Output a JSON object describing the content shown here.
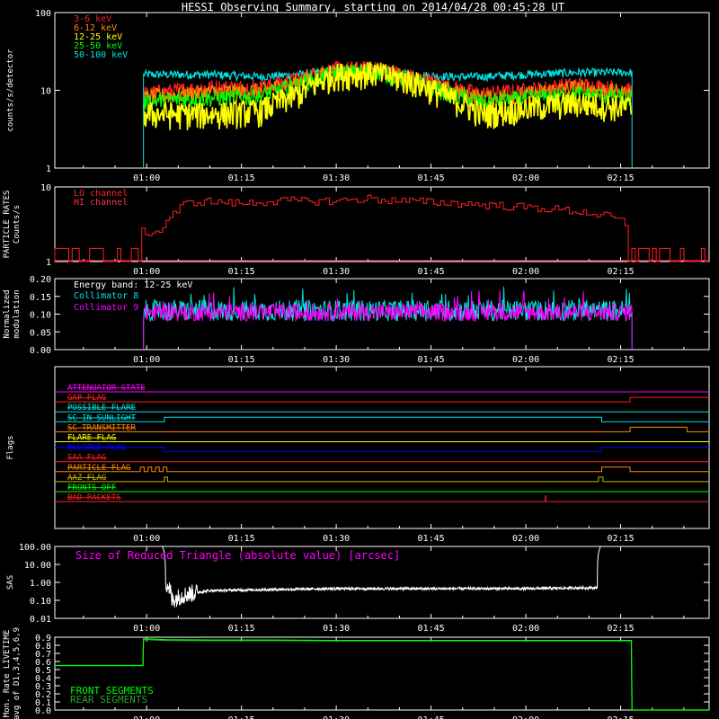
{
  "title": "HESSI Observing Summary, starting on 2014/04/28 00:45:28 UT",
  "x_ticks": [
    "01:00",
    "01:15",
    "01:30",
    "01:45",
    "02:00",
    "02:15"
  ],
  "x_tick_minutes": [
    60,
    75,
    90,
    105,
    120,
    135
  ],
  "x_range_minutes": [
    45.47,
    149
  ],
  "colors": {
    "white": "#ffffff",
    "red": "#ff2020",
    "orange": "#ff8800",
    "yellow": "#ffff00",
    "green": "#00ff00",
    "cyan": "#00e5e5",
    "magenta": "#ff00ff",
    "blue": "#0000ff",
    "darkyellow": "#c8b400",
    "olive": "#a08c00"
  },
  "chart_data": [
    {
      "type": "line",
      "panel": "count_rates",
      "ylabel": "counts/s/detector",
      "yscale": "log",
      "ylim": [
        1,
        100
      ],
      "y_ticks": [
        "1",
        "10",
        "100"
      ],
      "y_tick_values": [
        1,
        10,
        100
      ],
      "legend_position": "top-left",
      "data_span_minutes": [
        59.5,
        136.8
      ],
      "series": [
        {
          "name": "3-6 keV",
          "color": "#ff2020",
          "x": [
            59.5,
            62,
            70,
            78,
            84,
            90,
            96,
            102,
            108,
            113,
            120,
            128,
            136.8
          ],
          "y": [
            9,
            9.5,
            11,
            11,
            14,
            19,
            19,
            15,
            11,
            9,
            10,
            12,
            10
          ]
        },
        {
          "name": "6-12 keV",
          "color": "#ff8800",
          "x": [
            59.5,
            62,
            70,
            78,
            84,
            90,
            96,
            102,
            108,
            113,
            120,
            128,
            136.8
          ],
          "y": [
            8,
            8.5,
            9.5,
            10,
            13,
            18,
            18,
            14,
            10,
            8,
            9,
            11,
            9
          ]
        },
        {
          "name": "12-25 keV",
          "color": "#ffff00",
          "x": [
            59.5,
            62,
            70,
            78,
            84,
            90,
            96,
            102,
            108,
            113,
            120,
            128,
            136.8
          ],
          "y": [
            5,
            5,
            5,
            5.5,
            9,
            16,
            17,
            13,
            8,
            5,
            6,
            7,
            6
          ]
        },
        {
          "name": "25-50 keV",
          "color": "#00ff00",
          "x": [
            59.5,
            62,
            70,
            78,
            84,
            90,
            96,
            102,
            108,
            113,
            120,
            128,
            136.8
          ],
          "y": [
            7,
            7.5,
            8,
            8.5,
            12,
            17,
            17.5,
            13,
            9,
            7,
            8,
            9,
            8
          ]
        },
        {
          "name": "50-100 keV",
          "color": "#00e5e5",
          "x": [
            59.5,
            62,
            70,
            78,
            84,
            90,
            96,
            102,
            108,
            113,
            120,
            128,
            136.8
          ],
          "y": [
            16,
            16,
            16,
            15,
            16,
            18,
            18,
            16,
            15,
            15,
            16,
            17,
            17
          ]
        }
      ]
    },
    {
      "type": "line",
      "panel": "particle_rates",
      "ylabel": [
        "PARTICLE RATES",
        "Counts/s"
      ],
      "yscale": "log",
      "ylim": [
        1,
        10
      ],
      "y_ticks": [
        "1",
        "10"
      ],
      "y_tick_values": [
        1,
        10
      ],
      "legend_position": "top-left",
      "series": [
        {
          "name": "LO channel",
          "color": "#ff2020",
          "x": [
            45.5,
            52,
            53,
            58.5,
            59,
            62,
            63,
            65,
            66,
            69,
            75,
            80,
            90,
            95,
            100,
            110,
            125,
            130,
            133,
            135.5,
            136,
            149
          ],
          "y": [
            1.5,
            1.5,
            1,
            1,
            2.5,
            2.5,
            3.5,
            5,
            6,
            6.5,
            6,
            6.5,
            6.5,
            7,
            6.5,
            6,
            5,
            4.5,
            4,
            3.5,
            1.5,
            1.5
          ]
        },
        {
          "name": "HI channel",
          "color": "#ff3050",
          "x": [
            45.5,
            149
          ],
          "y": [
            1,
            1
          ]
        }
      ]
    },
    {
      "type": "line",
      "panel": "modulation",
      "ylabel": [
        "Normalized",
        "modulation"
      ],
      "ylim": [
        0,
        0.2
      ],
      "y_ticks": [
        "0.00",
        "0.05",
        "0.10",
        "0.15",
        "0.20"
      ],
      "y_tick_values": [
        0,
        0.05,
        0.1,
        0.15,
        0.2
      ],
      "legend_position": "top-left",
      "energy_band_label": "Energy band: 12-25 keV",
      "data_span_minutes": [
        59.5,
        136.8
      ],
      "series": [
        {
          "name": "Collimator 8",
          "color": "#00e5e5",
          "mean": 0.11,
          "spread": 0.03
        },
        {
          "name": "Collimator 9",
          "color": "#ff00ff",
          "mean": 0.105,
          "spread": 0.025
        }
      ]
    },
    {
      "type": "line",
      "panel": "flags",
      "ylabel": "Flags",
      "series": [
        {
          "name": "ATTENUATOR STATE",
          "color": "#ff00ff",
          "levels": [
            [
              45.5,
              0
            ]
          ]
        },
        {
          "name": "SAA_FLAG",
          "color": "#ff2020",
          "levels": [
            [
              45.5,
              0
            ],
            [
              136.5,
              1
            ]
          ],
          "label_text": "GAP_FLAG"
        },
        {
          "name": "POSSIBLE FLARE",
          "color": "#00e5e5",
          "levels": [
            [
              45.5,
              0
            ]
          ]
        },
        {
          "name": "SC IN SUNLIGHT",
          "color": "#00e5e5",
          "levels": [
            [
              45.5,
              0
            ],
            [
              62.8,
              1
            ],
            [
              132.0,
              0
            ]
          ]
        },
        {
          "name": "SC TRANSMITTER",
          "color": "#ff8800",
          "levels": [
            [
              45.5,
              0
            ],
            [
              136.5,
              1
            ],
            [
              145.5,
              0
            ]
          ]
        },
        {
          "name": "FLARE FLAG",
          "color": "#ffff00",
          "levels": [
            [
              45.5,
              0
            ]
          ]
        },
        {
          "name": "ECLIPSE FLAG",
          "color": "#0000ff",
          "levels": [
            [
              45.5,
              1
            ],
            [
              62.8,
              0
            ],
            [
              132.0,
              1
            ]
          ]
        },
        {
          "name": "SAA FLAG",
          "color": "#ff2020",
          "levels": [
            [
              45.5,
              0
            ]
          ]
        },
        {
          "name": "PARTICLE FLAG",
          "color": "#ff8800",
          "levels": [
            [
              45.5,
              0
            ],
            [
              59.0,
              1
            ],
            [
              59.6,
              0
            ],
            [
              60.2,
              1
            ],
            [
              60.8,
              0
            ],
            [
              61.4,
              1
            ],
            [
              62.0,
              0
            ],
            [
              62.6,
              1
            ],
            [
              63.2,
              0
            ],
            [
              136.5,
              0
            ]
          ],
          "tail": [
            [
              132.0,
              1
            ],
            [
              136.5,
              0
            ]
          ]
        },
        {
          "name": "AAZ FLAG",
          "color": "#c8b400",
          "levels": [
            [
              45.5,
              0
            ],
            [
              62.8,
              1
            ],
            [
              63.3,
              0
            ],
            [
              131.5,
              1
            ],
            [
              132.2,
              0
            ]
          ]
        },
        {
          "name": "FRONTS OFF",
          "color": "#00ff00",
          "levels": [
            [
              45.5,
              0
            ]
          ]
        },
        {
          "name": "BAD PACKETS",
          "color": "#ff2020",
          "levels": [
            [
              45.5,
              0
            ]
          ],
          "spikes": [
            123.1
          ]
        }
      ]
    },
    {
      "type": "line",
      "panel": "sas",
      "ylabel": "SAS",
      "yscale": "log",
      "ylim": [
        0.01,
        100
      ],
      "y_ticks": [
        "100.00",
        "10.00",
        "1.00",
        "0.10",
        "0.01"
      ],
      "y_tick_values": [
        100,
        10,
        1,
        0.1,
        0.01
      ],
      "annotation": "Size of Reduced Triangle (absolute value) [arcsec]",
      "data_span_minutes": [
        62.5,
        131.8
      ],
      "series": [
        {
          "name": "",
          "color": "#ffffff",
          "x": [
            62.5,
            63,
            64,
            66,
            70,
            80,
            90,
            100,
            110,
            120,
            130,
            131.3,
            131.8
          ],
          "y": [
            100,
            1,
            0.1,
            0.2,
            0.35,
            0.4,
            0.45,
            0.45,
            0.45,
            0.45,
            0.5,
            0.5,
            100
          ]
        }
      ]
    },
    {
      "type": "line",
      "panel": "livetime",
      "ylabel": [
        "Mon. Rate LIVETIME",
        "avg of D1,3,4,5,6,9"
      ],
      "ylim": [
        0,
        0.9
      ],
      "y_ticks": [
        "0.9",
        "0.8",
        "0.7",
        "0.6",
        "0.5",
        "0.4",
        "0.3",
        "0.2",
        "0.1",
        "0.0"
      ],
      "y_tick_values": [
        0.9,
        0.8,
        0.7,
        0.6,
        0.5,
        0.4,
        0.3,
        0.2,
        0.1,
        0.0
      ],
      "legend_position": "bottom-left",
      "series": [
        {
          "name": "FRONT SEGMENTS",
          "color": "#00ff00",
          "x": [
            45.5,
            59.4,
            59.5,
            60,
            63,
            70,
            80,
            90,
            100,
            110,
            120,
            130,
            136.7,
            136.8,
            149
          ],
          "y": [
            0.55,
            0.55,
            0.88,
            0.88,
            0.87,
            0.865,
            0.865,
            0.86,
            0.86,
            0.86,
            0.86,
            0.86,
            0.86,
            0,
            0
          ]
        },
        {
          "name": "REAR SEGMENTS",
          "color": "#2aa02a",
          "x": [
            45.5,
            59.4,
            59.5,
            60,
            63,
            70,
            80,
            90,
            100,
            110,
            120,
            130,
            136.7,
            136.8,
            149
          ],
          "y": [
            0.55,
            0.55,
            0.87,
            0.87,
            0.86,
            0.858,
            0.858,
            0.855,
            0.855,
            0.855,
            0.855,
            0.855,
            0.855,
            0,
            0
          ]
        }
      ]
    }
  ]
}
